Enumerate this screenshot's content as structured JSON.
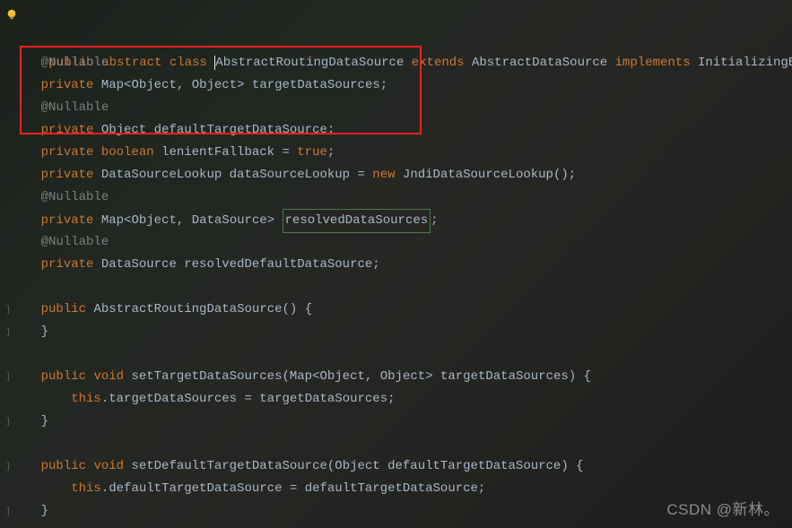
{
  "icons": {
    "bulb": "bulb-icon"
  },
  "watermark": "CSDN @新林。",
  "code": {
    "l1": {
      "k_public": "public",
      "k_abstract": "abstract",
      "k_class": "class",
      "name": "AbstractRoutingDataSource",
      "k_extends": "extends",
      "super": "AbstractDataSource",
      "k_implements": "implements",
      "iface": "InitializingBean",
      "brace": "{"
    },
    "l2": {
      "ann": "@Nullable"
    },
    "l3": {
      "k_private": "private",
      "type": "Map",
      "lt": "<",
      "t1": "Object",
      "comma": ", ",
      "t2": "Object",
      "gt": ">",
      "name": "targetDataSources",
      "semi": ";"
    },
    "l4": {
      "ann": "@Nullable"
    },
    "l5": {
      "k_private": "private",
      "type": "Object",
      "name": "defaultTargetDataSource",
      "semi": ";"
    },
    "l6": {
      "k_private": "private",
      "k_boolean": "boolean",
      "name": "lenientFallback",
      "eq": "=",
      "k_true": "true",
      "semi": ";"
    },
    "l7": {
      "k_private": "private",
      "type": "DataSourceLookup",
      "name": "dataSourceLookup",
      "eq": "=",
      "k_new": "new",
      "ctor": "JndiDataSourceLookup()",
      "semi": ";"
    },
    "l8": {
      "ann": "@Nullable"
    },
    "l9": {
      "k_private": "private",
      "type": "Map",
      "lt": "<",
      "t1": "Object",
      "comma": ", ",
      "t2": "DataSource",
      "gt": ">",
      "name": "resolvedDataSources",
      "semi": ";"
    },
    "l10": {
      "ann": "@Nullable"
    },
    "l11": {
      "k_private": "private",
      "type": "DataSource",
      "name": "resolvedDefaultDataSource",
      "semi": ";"
    },
    "l13": {
      "k_public": "public",
      "name": "AbstractRoutingDataSource()",
      "brace": "{"
    },
    "l14": {
      "brace": "}"
    },
    "l16": {
      "k_public": "public",
      "k_void": "void",
      "name": "setTargetDataSources(Map",
      "lt": "<",
      "t1": "Object",
      "comma": ", ",
      "t2": "Object",
      "gt": ">",
      "param": " targetDataSources)",
      "brace": "{"
    },
    "l17": {
      "k_this": "this",
      "dot": ".",
      "field": "targetDataSources",
      "eq": " = ",
      "val": "targetDataSources",
      "semi": ";"
    },
    "l18": {
      "brace": "}"
    },
    "l20": {
      "k_public": "public",
      "k_void": "void",
      "name": "setDefaultTargetDataSource(Object defaultTargetDataSource)",
      "brace": "{"
    },
    "l21": {
      "k_this": "this",
      "dot": ".",
      "field": "defaultTargetDataSource",
      "eq": " = ",
      "val": "defaultTargetDataSource",
      "semi": ";"
    },
    "l22": {
      "brace": "}"
    }
  }
}
